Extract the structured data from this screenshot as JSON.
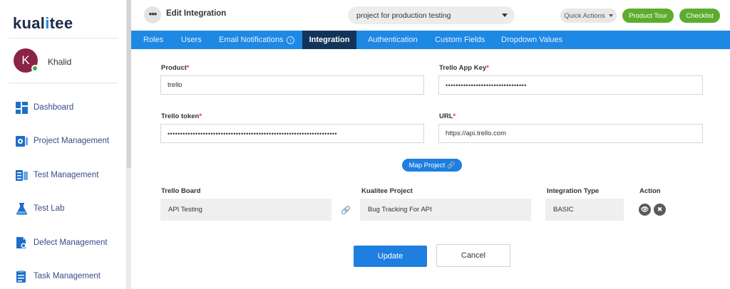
{
  "brand": {
    "logo_text": "kualitee"
  },
  "user": {
    "initial": "K",
    "name": "Khalid"
  },
  "sidebar": {
    "items": [
      {
        "label": "Dashboard",
        "icon": "dashboard-icon"
      },
      {
        "label": "Project Management",
        "icon": "project-management-icon"
      },
      {
        "label": "Test Management",
        "icon": "test-management-icon"
      },
      {
        "label": "Test Lab",
        "icon": "flask-icon"
      },
      {
        "label": "Defect Management",
        "icon": "defect-icon"
      },
      {
        "label": "Task Management",
        "icon": "task-icon"
      }
    ]
  },
  "header": {
    "menu_glyph": "•••",
    "title": "Edit Integration",
    "project_selector": "project for production testing",
    "quick_actions": "Quick Actions",
    "product_tour": "Product Tour",
    "checklist": "Checklist"
  },
  "tabs": [
    {
      "label": "Roles",
      "active": false
    },
    {
      "label": "Users",
      "active": false
    },
    {
      "label": "Email Notifications",
      "active": false,
      "info": "i"
    },
    {
      "label": "Integration",
      "active": true
    },
    {
      "label": "Authentication",
      "active": false
    },
    {
      "label": "Custom Fields",
      "active": false
    },
    {
      "label": "Dropdown Values",
      "active": false
    }
  ],
  "form": {
    "product": {
      "label": "Product",
      "required": "*",
      "value": "trello"
    },
    "trello_app_key": {
      "label": "Trello App Key",
      "required": "*",
      "value": "••••••••••••••••••••••••••••••••"
    },
    "trello_token": {
      "label": "Trello token",
      "required": "*",
      "value": "•••••••••••••••••••••••••••••••••••••••••••••••••••••••••••••••••••"
    },
    "url": {
      "label": "URL",
      "required": "*",
      "value": "https://api.trello.com"
    }
  },
  "map_project": {
    "label": "Map Project",
    "glyph": "🔗"
  },
  "mapping": {
    "headers": {
      "trello_board": "Trello Board",
      "kualitee_project": "Kualitee Project",
      "integration_type": "Integration Type",
      "action": "Action"
    },
    "row": {
      "trello_board": "API Testing",
      "kualitee_project": "Bug Tracking For API",
      "integration_type": "BASIC",
      "link_glyph": "🔗",
      "view_glyph": "👁",
      "remove_glyph": "✖"
    }
  },
  "buttons": {
    "update": "Update",
    "cancel": "Cancel"
  },
  "colors": {
    "primary_blue": "#1e88e5",
    "active_tab": "#13345a",
    "green": "#5cad2d",
    "avatar": "#8b2346",
    "required": "#e53935"
  }
}
